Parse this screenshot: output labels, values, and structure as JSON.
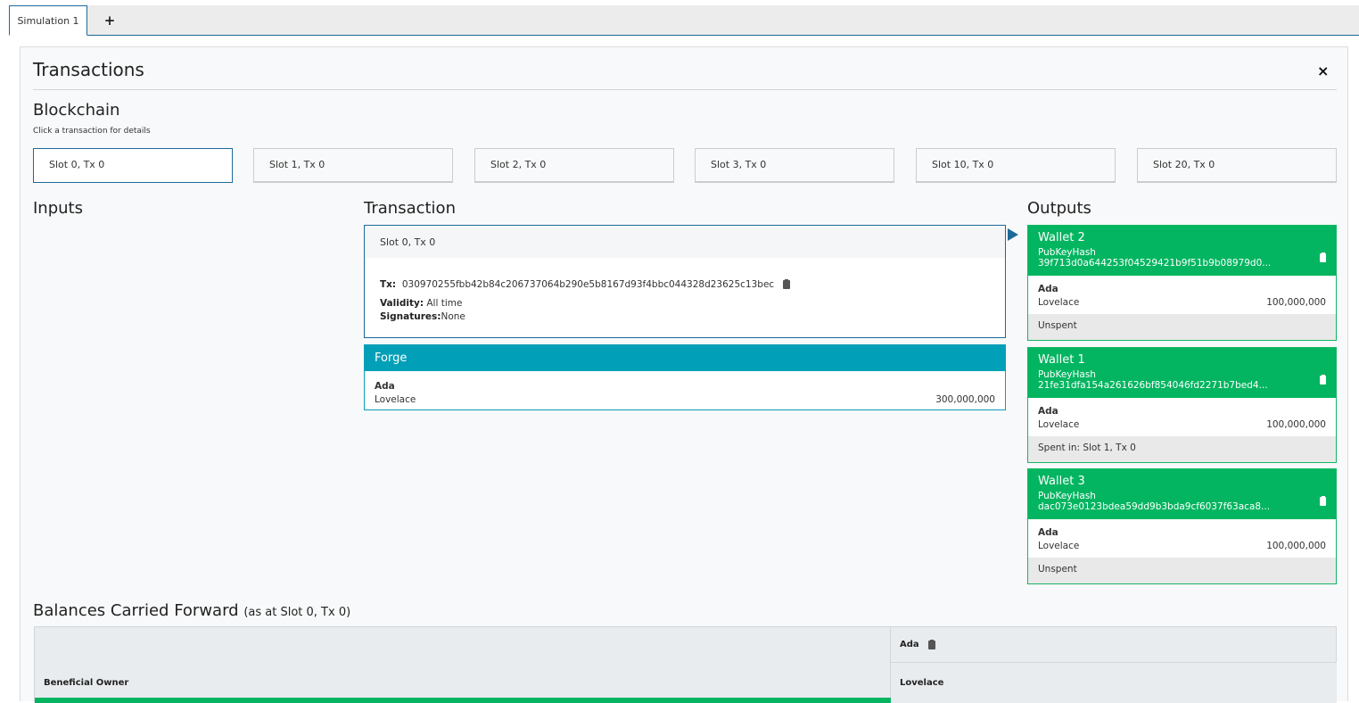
{
  "tabs": [
    {
      "label": "Simulation 1",
      "active": true
    },
    {
      "label": "+"
    }
  ],
  "panel": {
    "title": "Transactions",
    "close": "×"
  },
  "blockchain": {
    "title": "Blockchain",
    "hint": "Click a transaction for details",
    "slots": [
      "Slot 0, Tx 0",
      "Slot 1, Tx 0",
      "Slot 2, Tx 0",
      "Slot 3, Tx 0",
      "Slot 10, Tx 0",
      "Slot 20, Tx 0"
    ]
  },
  "columns": {
    "inputs": "Inputs",
    "transaction": "Transaction",
    "outputs": "Outputs"
  },
  "transaction": {
    "header": "Slot 0, Tx 0",
    "tx_label": "Tx:",
    "tx_hash": "030970255fbb42b84c206737064b290e5b8167d93f4bbc044328d23625c13bec",
    "validity_label": "Validity:",
    "validity_value": "All time",
    "signatures_label": "Signatures:",
    "signatures_value": "None"
  },
  "forge": {
    "title": "Forge",
    "currency": "Ada",
    "token": "Lovelace",
    "amount": "300,000,000"
  },
  "outputs": [
    {
      "wallet": "Wallet 2",
      "key": "PubKeyHash 39f713d0a644253f04529421b9f51b9b08979d0...",
      "currency": "Ada",
      "token": "Lovelace",
      "amount": "100,000,000",
      "status": "Unspent"
    },
    {
      "wallet": "Wallet 1",
      "key": "PubKeyHash 21fe31dfa154a261626bf854046fd2271b7bed4...",
      "currency": "Ada",
      "token": "Lovelace",
      "amount": "100,000,000",
      "status": "Spent in: Slot 1, Tx 0"
    },
    {
      "wallet": "Wallet 3",
      "key": "PubKeyHash dac073e0123bdea59dd9b3bda9cf6037f63aca8...",
      "currency": "Ada",
      "token": "Lovelace",
      "amount": "100,000,000",
      "status": "Unspent"
    }
  ],
  "balances": {
    "title": "Balances Carried Forward",
    "subtitle": "(as at Slot 0, Tx 0)",
    "owner_header": "Beneficial Owner",
    "currency_header": "Ada",
    "token_header": "Lovelace"
  },
  "colors": {
    "accent": "#1d6a9a",
    "forge": "#02a0b8",
    "wallet": "#03b560"
  }
}
